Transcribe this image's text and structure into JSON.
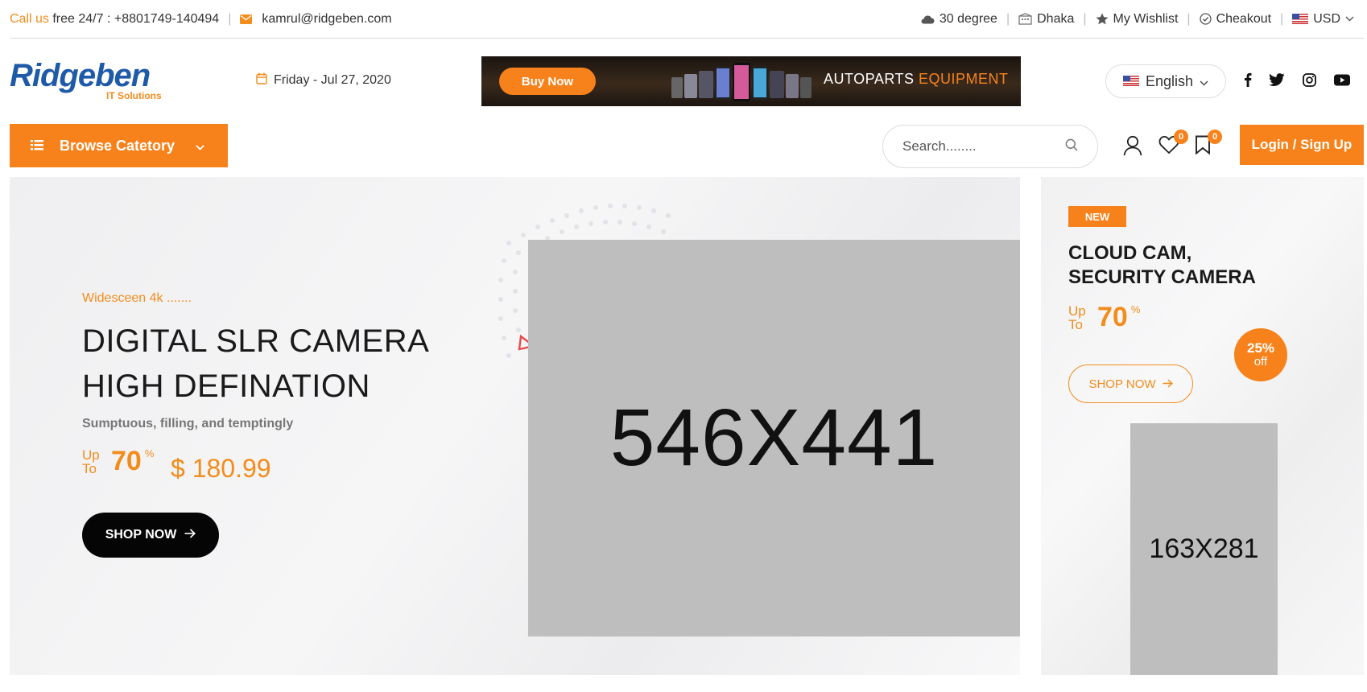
{
  "topbar": {
    "call_label": "Call us",
    "call_text": "free 24/7 : +8801749-140494",
    "email": "kamrul@ridgeben.com",
    "weather": "30 degree",
    "city": "Dhaka",
    "wishlist": "My Wishlist",
    "checkout": "Cheakout",
    "currency": "USD"
  },
  "header": {
    "logo_word": "Ridgeben",
    "logo_sub": "IT Solutions",
    "date": "Friday - Jul 27, 2020",
    "banner": {
      "button": "Buy Now",
      "text_white": "AUTOPARTS",
      "text_orange": "EQUIPMENT"
    },
    "language": "English",
    "socials": [
      "facebook-icon",
      "twitter-icon",
      "instagram-icon",
      "youtube-icon"
    ]
  },
  "nav": {
    "browse_label": "Browse Catetory",
    "search_placeholder": "Search........",
    "wishlist_count": "0",
    "saved_count": "0",
    "login_label": "Login / Sign Up"
  },
  "hero": {
    "subtitle": "Widesceen 4k .......",
    "title_line1": "DIGITAL SLR CAMERA",
    "title_line2": "HIGH DEFINATION",
    "description": "Sumptuous, filling, and temptingly",
    "upto_line1": "Up",
    "upto_line2": "To",
    "discount": "70",
    "percent": "%",
    "price": "$ 180.99",
    "shop_label": "SHOP NOW",
    "image_placeholder": "546X441"
  },
  "side": {
    "badge": "NEW",
    "title_line1": "CLOUD CAM,",
    "title_line2": "SECURITY CAMERA",
    "upto_line1": "Up",
    "upto_line2": "To",
    "discount": "70",
    "percent": "%",
    "off_pct": "25%",
    "off_word": "off",
    "shop_label": "SHOP NOW",
    "image_placeholder": "163X281"
  },
  "colors": {
    "accent": "#f7821b",
    "brand_blue": "#1e5aa8",
    "placeholder_gray": "#bebebe"
  }
}
